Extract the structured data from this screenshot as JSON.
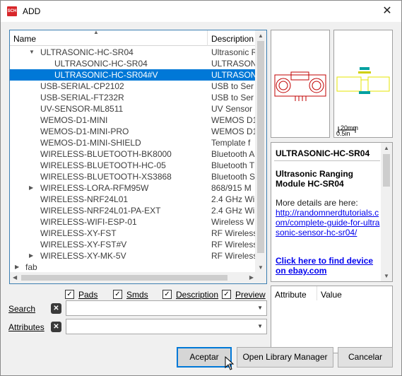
{
  "window": {
    "icon_text": "SCH",
    "title": "ADD",
    "close_glyph": "✕"
  },
  "tree": {
    "columns": {
      "name": "Name",
      "description": "Description"
    },
    "rows": [
      {
        "name": "ULTRASONIC-HC-SR04",
        "description": "Ultrasonic R",
        "level": 1,
        "expander": "expanded",
        "selected": false
      },
      {
        "name": "ULTRASONIC-HC-SR04",
        "description": "ULTRASON",
        "level": 2,
        "expander": "none",
        "selected": false
      },
      {
        "name": "ULTRASONIC-HC-SR04#V",
        "description": "ULTRASON",
        "level": 2,
        "expander": "none",
        "selected": true
      },
      {
        "name": "USB-SERIAL-CP2102",
        "description": "USB to Ser",
        "level": 1,
        "expander": "none",
        "selected": false
      },
      {
        "name": "USB-SERIAL-FT232R",
        "description": "USB to Ser",
        "level": 1,
        "expander": "none",
        "selected": false
      },
      {
        "name": "UV-SENSOR-ML8511",
        "description": "UV  Sensor",
        "level": 1,
        "expander": "none",
        "selected": false
      },
      {
        "name": "WEMOS-D1-MINI",
        "description": "WEMOS D1",
        "level": 1,
        "expander": "none",
        "selected": false
      },
      {
        "name": "WEMOS-D1-MINI-PRO",
        "description": "WEMOS D1",
        "level": 1,
        "expander": "none",
        "selected": false
      },
      {
        "name": "WEMOS-D1-MINI-SHIELD",
        "description": "Template f",
        "level": 1,
        "expander": "none",
        "selected": false
      },
      {
        "name": "WIRELESS-BLUETOOTH-BK8000",
        "description": "Bluetooth A",
        "level": 1,
        "expander": "none",
        "selected": false
      },
      {
        "name": "WIRELESS-BLUETOOTH-HC-05",
        "description": "Bluetooth T",
        "level": 1,
        "expander": "none",
        "selected": false
      },
      {
        "name": "WIRELESS-BLUETOOTH-XS3868",
        "description": "Bluetooth S",
        "level": 1,
        "expander": "none",
        "selected": false
      },
      {
        "name": "WIRELESS-LORA-RFM95W",
        "description": "868/915 M",
        "level": 1,
        "expander": "collapsed",
        "selected": false
      },
      {
        "name": "WIRELESS-NRF24L01",
        "description": "2.4 GHz Wi",
        "level": 1,
        "expander": "none",
        "selected": false
      },
      {
        "name": "WIRELESS-NRF24L01-PA-EXT",
        "description": "2.4 GHz Wi",
        "level": 1,
        "expander": "none",
        "selected": false
      },
      {
        "name": "WIRELESS-WIFI-ESP-01",
        "description": "Wireless W",
        "level": 1,
        "expander": "none",
        "selected": false
      },
      {
        "name": "WIRELESS-XY-FST",
        "description": "RF Wireless",
        "level": 1,
        "expander": "none",
        "selected": false
      },
      {
        "name": "WIRELESS-XY-FST#V",
        "description": "RF Wireless",
        "level": 1,
        "expander": "none",
        "selected": false
      },
      {
        "name": "WIRELESS-XY-MK-5V",
        "description": "RF Wireless",
        "level": 1,
        "expander": "collapsed",
        "selected": false
      },
      {
        "name": "fab",
        "description": "",
        "level": 0,
        "expander": "collapsed",
        "selected": false
      }
    ]
  },
  "package_preview": {
    "scale_label": "20mm",
    "scale_sub": "0.5in"
  },
  "info": {
    "device_name": "ULTRASONIC-HC-SR04",
    "heading": "Ultrasonic Ranging Module HC-SR04",
    "more_details": "More details are here:",
    "link": "http://randomnerdtutorials.com/complete-guide-for-ultrasonic-sensor-hc-sr04/",
    "ebay_link": "Click here to find device on ebay.com"
  },
  "attributes": {
    "col_attribute": "Attribute",
    "col_value": "Value"
  },
  "filters": {
    "pads": {
      "label": "Pads",
      "checked": true
    },
    "smds": {
      "label": "Smds",
      "checked": true
    },
    "description": {
      "label": "Description",
      "checked": true
    },
    "preview": {
      "label": "Preview",
      "checked": true
    }
  },
  "search": {
    "label": "Search",
    "value": ""
  },
  "attributes_filter": {
    "label": "Attributes",
    "value": ""
  },
  "buttons": {
    "ok": "Aceptar",
    "library_manager": "Open Library Manager",
    "cancel": "Cancelar"
  },
  "colors": {
    "selection": "#0078d7",
    "symbol_lines": "#c00000",
    "pkg_outline": "#e5e500",
    "pkg_pads": "#00a0a0",
    "link": "#0000ee"
  }
}
